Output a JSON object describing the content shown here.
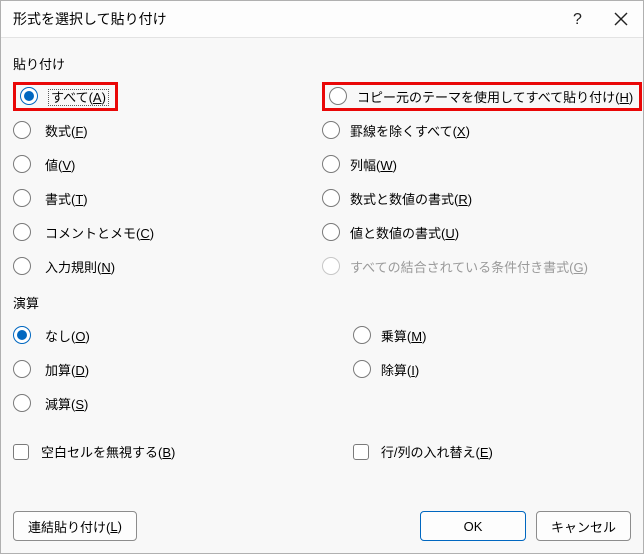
{
  "dialog": {
    "title": "形式を選択して貼り付け",
    "help_icon": "help-icon",
    "close_icon": "close-icon"
  },
  "paste_group": {
    "label": "貼り付け"
  },
  "paste_left": [
    {
      "id": "all",
      "pre": "すべて(",
      "acc": "A",
      "post": ")",
      "checked": true,
      "disabled": false,
      "emph": true
    },
    {
      "id": "formulas",
      "pre": "数式(",
      "acc": "F",
      "post": ")",
      "checked": false,
      "disabled": false
    },
    {
      "id": "values",
      "pre": "値(",
      "acc": "V",
      "post": ")",
      "checked": false,
      "disabled": false
    },
    {
      "id": "formats",
      "pre": "書式(",
      "acc": "T",
      "post": ")",
      "checked": false,
      "disabled": false
    },
    {
      "id": "comments",
      "pre": "コメントとメモ(",
      "acc": "C",
      "post": ")",
      "checked": false,
      "disabled": false
    },
    {
      "id": "validation",
      "pre": "入力規則(",
      "acc": "N",
      "post": ")",
      "checked": false,
      "disabled": false
    }
  ],
  "paste_right": [
    {
      "id": "theme",
      "pre": "コピー元のテーマを使用してすべて貼り付け(",
      "acc": "H",
      "post": ")",
      "checked": false,
      "disabled": false,
      "emph": true
    },
    {
      "id": "noborder",
      "pre": "罫線を除くすべて(",
      "acc": "X",
      "post": ")",
      "checked": false,
      "disabled": false
    },
    {
      "id": "colwidth",
      "pre": "列幅(",
      "acc": "W",
      "post": ")",
      "checked": false,
      "disabled": false
    },
    {
      "id": "formnum",
      "pre": "数式と数値の書式(",
      "acc": "R",
      "post": ")",
      "checked": false,
      "disabled": false
    },
    {
      "id": "valnum",
      "pre": "値と数値の書式(",
      "acc": "U",
      "post": ")",
      "checked": false,
      "disabled": false
    },
    {
      "id": "condfmt",
      "pre": "すべての結合されている条件付き書式(",
      "acc": "G",
      "post": ")",
      "checked": false,
      "disabled": true
    }
  ],
  "operation_group": {
    "label": "演算"
  },
  "op_left": [
    {
      "id": "none",
      "pre": "なし(",
      "acc": "O",
      "post": ")",
      "checked": true
    },
    {
      "id": "add",
      "pre": "加算(",
      "acc": "D",
      "post": ")",
      "checked": false
    },
    {
      "id": "sub",
      "pre": "減算(",
      "acc": "S",
      "post": ")",
      "checked": false
    }
  ],
  "op_right": [
    {
      "id": "mul",
      "pre": "乗算(",
      "acc": "M",
      "post": ")",
      "checked": false
    },
    {
      "id": "div",
      "pre": "除算(",
      "acc": "I",
      "post": ")",
      "checked": false
    }
  ],
  "checks": {
    "skip_blanks": {
      "pre": "空白セルを無視する(",
      "acc": "B",
      "post": ")",
      "checked": false
    },
    "transpose": {
      "pre": "行/列の入れ替え(",
      "acc": "E",
      "post": ")",
      "checked": false
    }
  },
  "buttons": {
    "paste_link": {
      "pre": "連結貼り付け(",
      "acc": "L",
      "post": ")"
    },
    "ok": "OK",
    "cancel": "キャンセル"
  }
}
